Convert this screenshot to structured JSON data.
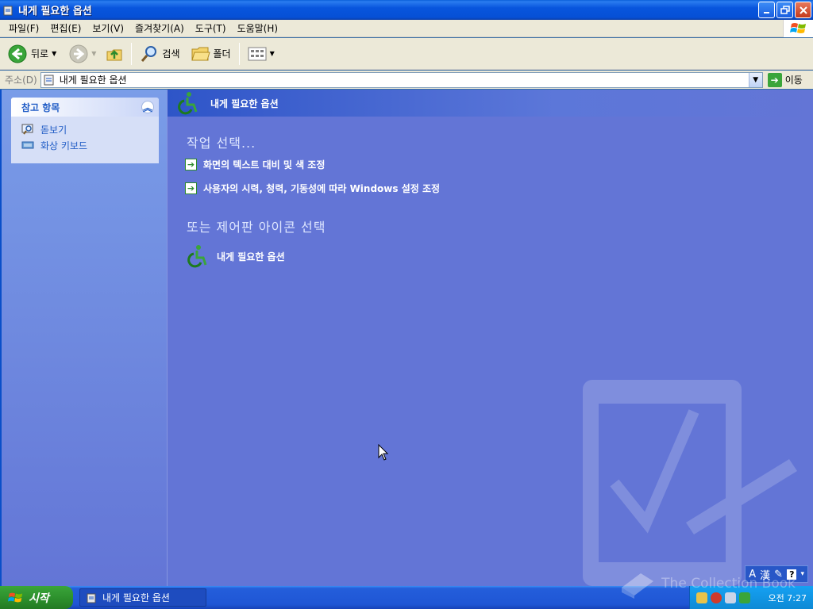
{
  "window": {
    "title": "내게 필요한 옵션"
  },
  "menubar": {
    "items": [
      "파일(F)",
      "편집(E)",
      "보기(V)",
      "즐겨찾기(A)",
      "도구(T)",
      "도움말(H)"
    ]
  },
  "toolbar": {
    "back_label": "뒤로",
    "search_label": "검색",
    "folders_label": "폴더"
  },
  "address": {
    "label": "주소(D)",
    "value": "내게 필요한 옵션",
    "go_label": "이동"
  },
  "sidebar": {
    "section_title": "참고 항목",
    "links": [
      {
        "label": "돋보기",
        "icon": "magnifier-icon"
      },
      {
        "label": "화상 키보드",
        "icon": "keyboard-icon"
      }
    ]
  },
  "main": {
    "banner_title": "내게 필요한 옵션",
    "pick_task_title": "작업 선택...",
    "tasks": [
      "화면의 텍스트 대비 및 색 조정",
      "사용자의 시력, 청력, 기동성에 따라 Windows 설정 조정"
    ],
    "pick_icon_title": "또는 제어판 아이콘 선택",
    "icons": [
      {
        "label": "내게 필요한 옵션",
        "icon": "accessibility-icon"
      }
    ]
  },
  "taskbar": {
    "start_label": "시작",
    "items": [
      "내게 필요한 옵션"
    ],
    "language_bar": [
      "A",
      "漢"
    ],
    "clock": "오전 7:27"
  },
  "watermark_text": "The Collection Book",
  "colors": {
    "xp_blue": "#0855dd",
    "content_bg": "#6375d6",
    "start_green": "#2b8d2b",
    "link_blue": "#215dc6"
  }
}
